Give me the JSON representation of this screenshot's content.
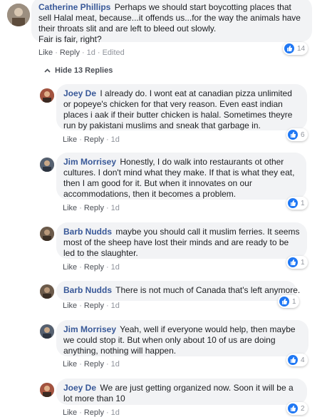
{
  "main_comment": {
    "author": "Catherine Phillips",
    "text": "Perhaps we should start boycotting places that sell Halal meat, because...it offends us...for the way the animals have their throats slit and are left to bleed out slowly.",
    "text2": "Fair is fair, right?",
    "like": "Like",
    "reply": "Reply",
    "time": "1d",
    "edited": "Edited",
    "reactions": "14"
  },
  "hide_replies": "Hide 13 Replies",
  "replies": [
    {
      "author": "Joey De",
      "text": "I already do. I wont eat at canadian pizza unlimited or popeye's chicken for that very reason. Even east indian places i aak if their butter chicken is halal. Sometimes theyre run by pakistani muslims and sneak that garbage in.",
      "like": "Like",
      "reply": "Reply",
      "time": "1d",
      "reactions": "6"
    },
    {
      "author": "Jim Morrisey",
      "text": "Honestly, I do walk into restaurants ot other cultures. I don't mind what they make. If that is what they eat, then I am good for it. But when it innovates on our accommodations, then it becomes a problem.",
      "like": "Like",
      "reply": "Reply",
      "time": "1d",
      "reactions": "1"
    },
    {
      "author": "Barb Nudds",
      "text": "maybe you should call it muslim ferries. It seems most of the sheep have lost their minds and are ready to be led to the slaughter.",
      "like": "Like",
      "reply": "Reply",
      "time": "1d",
      "reactions": "1"
    },
    {
      "author": "Barb Nudds",
      "text": "There is not much of Canada that's left anymore.",
      "like": "Like",
      "reply": "Reply",
      "time": "1d",
      "reactions": "1"
    },
    {
      "author": "Jim Morrisey",
      "text": "Yeah, well if everyone would help, then maybe we could stop it. But when only about 10 of us are doing anything, nothing will happen.",
      "like": "Like",
      "reply": "Reply",
      "time": "1d",
      "reactions": "4"
    },
    {
      "author": "Joey De",
      "text": "We are just getting organized now. Soon it will be a lot more than 10",
      "like": "Like",
      "reply": "Reply",
      "time": "1d",
      "reactions": "2"
    }
  ],
  "colors": {
    "author": "#385898",
    "bubble": "#f2f3f5",
    "like_icon": "#2078f4"
  },
  "icons": {
    "reaction": "thumbs-up-icon",
    "hide": "chevron-up-icon"
  }
}
